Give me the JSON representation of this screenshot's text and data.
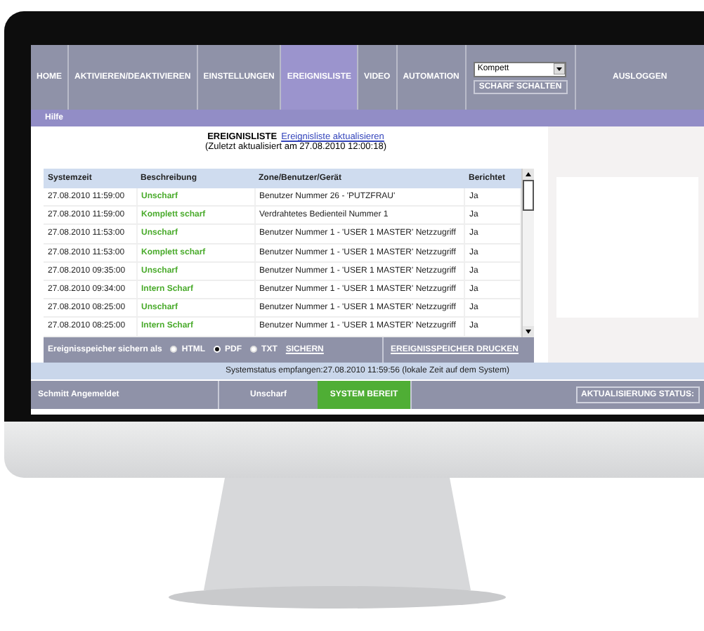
{
  "nav": {
    "items": [
      {
        "label": "HOME",
        "selected": false
      },
      {
        "label": "AKTIVIEREN/DEAKTIVIEREN",
        "selected": false
      },
      {
        "label": "EINSTELLUNGEN",
        "selected": false
      },
      {
        "label": "EREIGNISLISTE",
        "selected": true
      },
      {
        "label": "VIDEO",
        "selected": false
      },
      {
        "label": "AUTOMATION",
        "selected": false
      }
    ],
    "mode_select": "Kompett",
    "arm_button": "SCHARF SCHALTEN",
    "logout": "AUSLOGGEN"
  },
  "help_bar": "Hilfe",
  "event_list": {
    "title": "EREIGNISLISTE",
    "refresh_link": "Ereignisliste aktualisieren",
    "last_updated": "(Zuletzt aktualisiert am 27.08.2010 12:00:18)",
    "columns": [
      "Systemzeit",
      "Beschreibung",
      "Zone/Benutzer/Gerät",
      "Berichtet"
    ],
    "rows": [
      {
        "time": "27.08.2010 11:59:00",
        "description": "Unscharf",
        "zone": "Benutzer Nummer 26 - 'PUTZFRAU'",
        "reported": "Ja"
      },
      {
        "time": "27.08.2010 11:59:00",
        "description": "Komplett scharf",
        "zone": "Verdrahtetes Bedienteil Nummer 1",
        "reported": "Ja"
      },
      {
        "time": "27.08.2010 11:53:00",
        "description": "Unscharf",
        "zone": "Benutzer Nummer 1 - 'USER 1 MASTER' Netzzugriff",
        "reported": "Ja"
      },
      {
        "time": "27.08.2010 11:53:00",
        "description": "Komplett scharf",
        "zone": "Benutzer Nummer 1 - 'USER 1 MASTER' Netzzugriff",
        "reported": "Ja"
      },
      {
        "time": "27.08.2010 09:35:00",
        "description": "Unscharf",
        "zone": "Benutzer Nummer 1 - 'USER 1 MASTER' Netzzugriff",
        "reported": "Ja"
      },
      {
        "time": "27.08.2010 09:34:00",
        "description": "Intern Scharf",
        "zone": "Benutzer Nummer 1 - 'USER 1 MASTER' Netzzugriff",
        "reported": "Ja"
      },
      {
        "time": "27.08.2010 08:25:00",
        "description": "Unscharf",
        "zone": "Benutzer Nummer 1 - 'USER 1 MASTER' Netzzugriff",
        "reported": "Ja"
      },
      {
        "time": "27.08.2010 08:25:00",
        "description": "Intern Scharf",
        "zone": "Benutzer Nummer 1 - 'USER 1 MASTER' Netzzugriff",
        "reported": "Ja"
      }
    ]
  },
  "export": {
    "label": "Ereignisspeicher sichern als",
    "formats": [
      {
        "label": "HTML",
        "selected": false
      },
      {
        "label": "PDF",
        "selected": true
      },
      {
        "label": "TXT",
        "selected": false
      }
    ],
    "save_link": "SICHERN",
    "print_link": "EREIGNISSPEICHER DRUCKEN"
  },
  "status_line": "Systemstatus empfangen:27.08.2010 11:59:56 (lokale Zeit auf dem System)",
  "status_bar": {
    "user": "Schmitt Angemeldet",
    "arm_state": "Unscharf",
    "system_state": "SYSTEM BEREIT",
    "refresh_button": "AKTUALISIERUNG STATUS:"
  }
}
